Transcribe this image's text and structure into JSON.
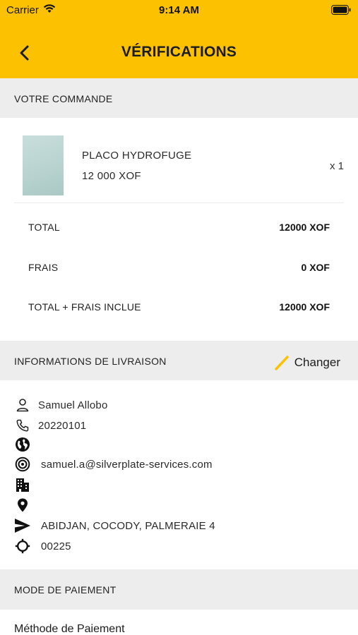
{
  "status_bar": {
    "carrier": "Carrier",
    "time": "9:14 AM"
  },
  "header": {
    "title": "VÉRIFICATIONS",
    "back_icon": "chevron-left-icon"
  },
  "order": {
    "section_label": "VOTRE COMMANDE",
    "product": {
      "name": "PLACO HYDROFUGE",
      "price": "12 000 XOF",
      "quantity": "x 1"
    },
    "summary": [
      {
        "label": "TOTAL",
        "value": "12000 XOF"
      },
      {
        "label": "FRAIS",
        "value": "0 XOF"
      },
      {
        "label": "TOTAL + FRAIS INCLUE",
        "value": "12000 XOF"
      }
    ]
  },
  "delivery": {
    "section_label": "INFORMATIONS DE LIVRAISON",
    "change_label": "Changer",
    "name": "Samuel Allobo",
    "phone": "20220101",
    "country": "",
    "email": "samuel.a@silverplate-services.com",
    "company": "",
    "location": "",
    "address": "ABIDJAN, COCODY, PALMERAIE 4",
    "postal_code": "00225"
  },
  "payment": {
    "section_label": "MODE DE PAIEMENT",
    "method_label": "Méthode de Paiement"
  },
  "colors": {
    "header_bg": "#fcc100",
    "section_bg": "#ededed",
    "accent": "#fcc100"
  }
}
